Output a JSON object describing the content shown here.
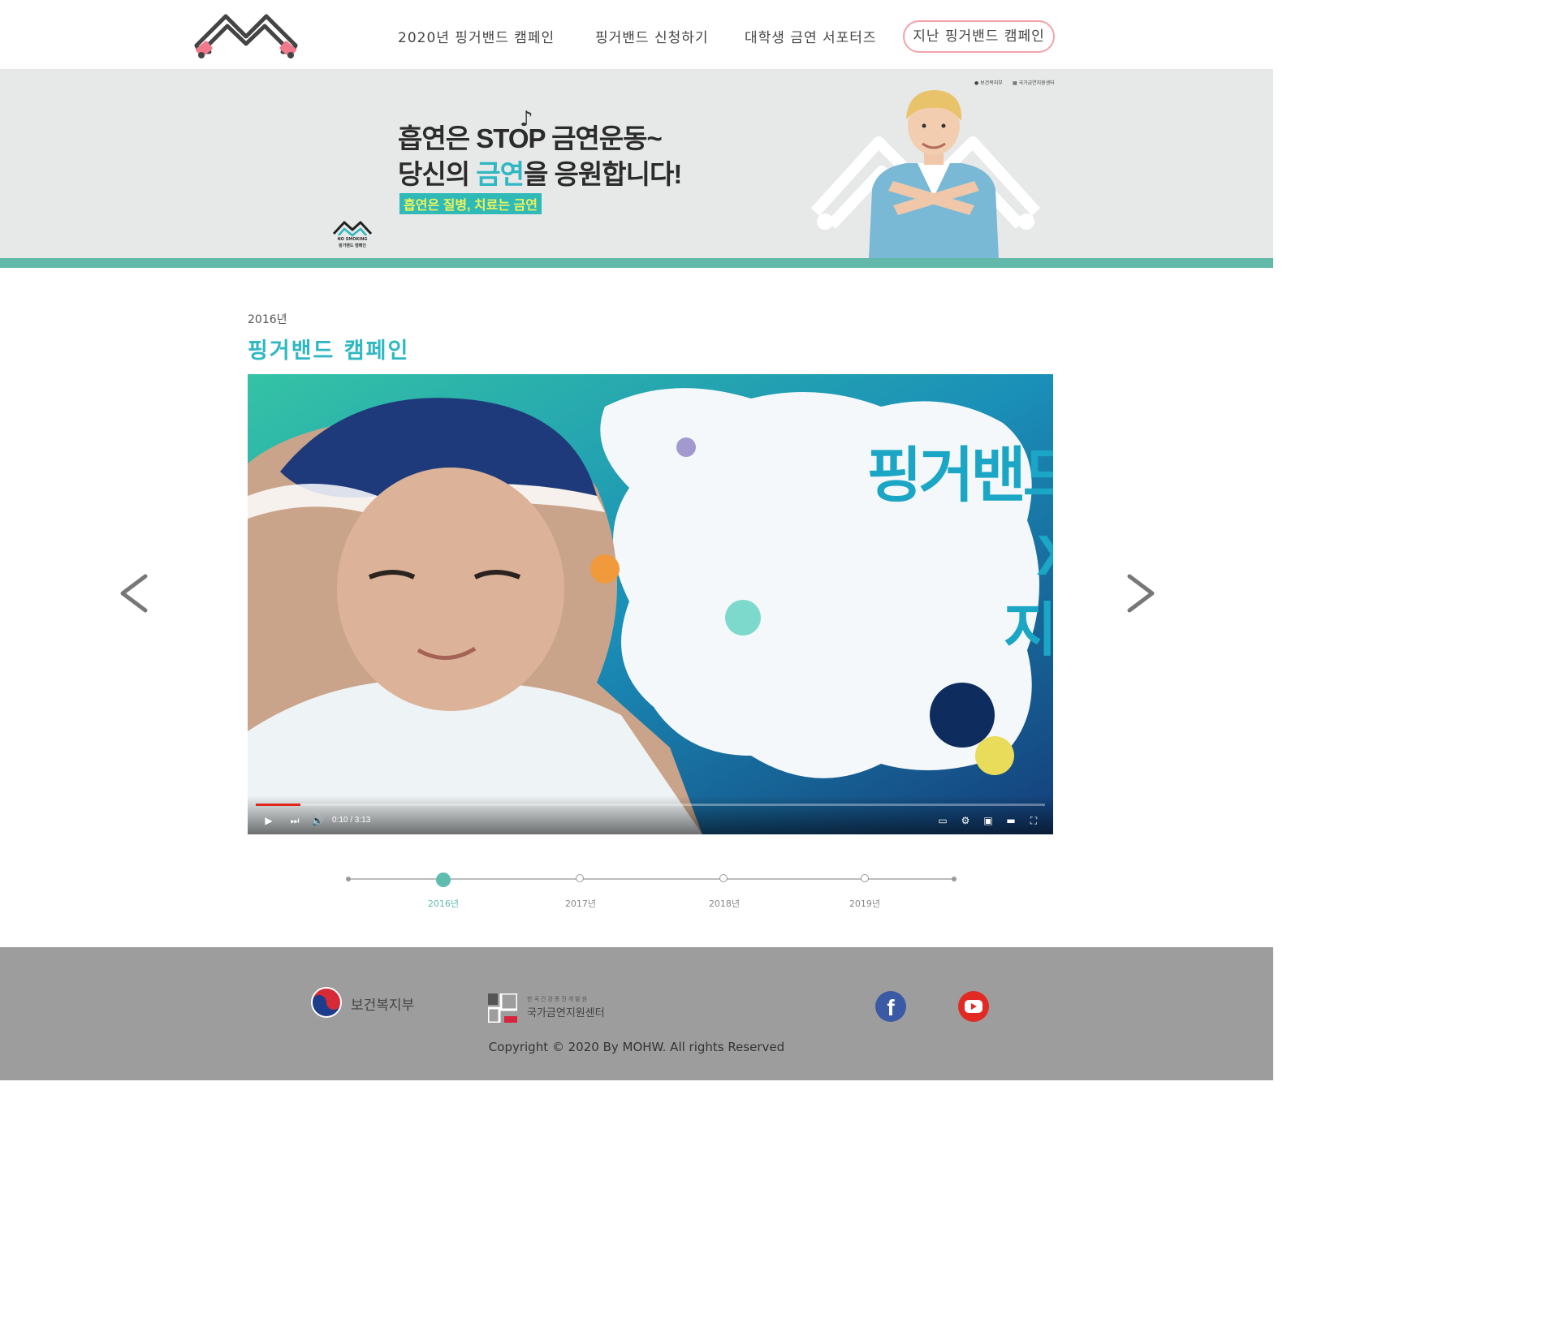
{
  "header": {
    "nav": [
      {
        "label": "2020년 핑거밴드 캠페인"
      },
      {
        "label": "핑거밴드 신청하기"
      },
      {
        "label": "대학생 금연 서포터즈"
      },
      {
        "label": "지난 핑거밴드 캠페인"
      }
    ]
  },
  "banner": {
    "line1": "흡연은 STOP 금연운동~",
    "line2_pre": "당신의 ",
    "line2_highlight": "금연",
    "line2_post": "을 응원합니다!",
    "tag": "흡연은 질병, 치료는 금연",
    "small_logo_line1": "NO SMOKING",
    "small_logo_line2": "핑거밴드 캠페인",
    "org1": "보건복지부",
    "org2": "국가금연지원센터",
    "accent_color": "#62b8a9"
  },
  "section": {
    "year": "2016년",
    "title": "핑거밴드 캠페인"
  },
  "video": {
    "title_line1": "핑거밴드 금연송",
    "title_line2": "X",
    "title_line3": "지코",
    "time": "0:10 / 3:13",
    "progress": 0.057
  },
  "timeline": {
    "items": [
      {
        "label": "2016년",
        "active": true
      },
      {
        "label": "2017년",
        "active": false
      },
      {
        "label": "2018년",
        "active": false
      },
      {
        "label": "2019년",
        "active": false
      }
    ]
  },
  "footer": {
    "org1": "보건복지부",
    "org2_small": "한국건강증진개발원",
    "org2": "국가금연지원센터",
    "copyright": "Copyright © 2020 By MOHW. All rights Reserved"
  }
}
